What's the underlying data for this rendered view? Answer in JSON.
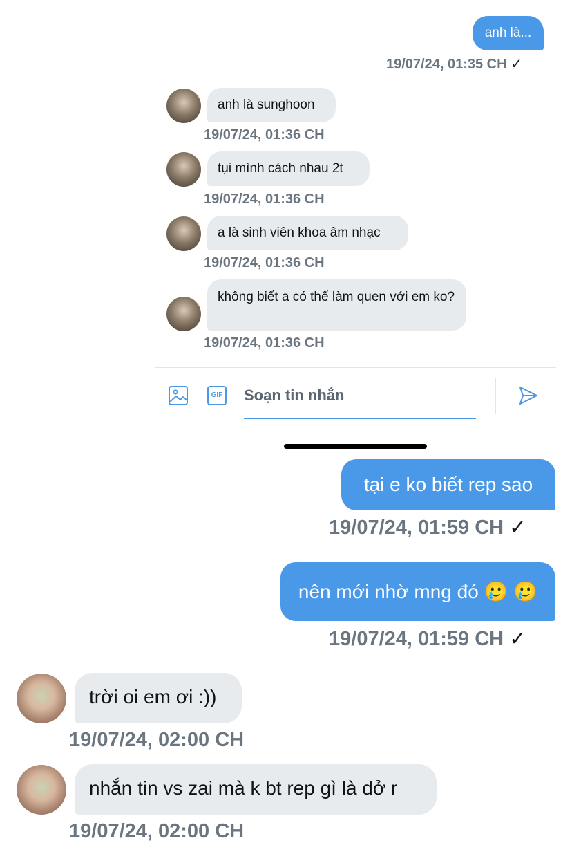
{
  "colors": {
    "accent": "#4a99e9",
    "incoming_bubble": "#e8ebee",
    "timestamp": "#6a7580"
  },
  "top_thread": {
    "outgoing": {
      "text": "anh là...",
      "time": "19/07/24, 01:35 CH",
      "check": "✓"
    },
    "incoming": [
      {
        "text": "anh là sunghoon",
        "time": "19/07/24, 01:36 CH"
      },
      {
        "text": "tụi mình cách nhau 2t",
        "time": "19/07/24, 01:36 CH"
      },
      {
        "text": "a là sinh viên khoa âm nhạc",
        "time": "19/07/24, 01:36 CH"
      },
      {
        "text": "không biết a có thể làm quen với em ko?",
        "time": "19/07/24, 01:36 CH"
      }
    ],
    "composer": {
      "placeholder": "Soạn tin nhắn",
      "image_icon": "image-icon",
      "gif_label": "GIF",
      "send_icon": "send-icon"
    }
  },
  "bottom_thread": {
    "outgoing": [
      {
        "text": "tại e ko biết rep sao",
        "time": "19/07/24, 01:59 CH",
        "check": "✓"
      },
      {
        "text": "nên mới nhờ mng đó 🥲 🥲",
        "time": "19/07/24, 01:59 CH",
        "check": "✓"
      }
    ],
    "incoming": [
      {
        "text": "trời oi em ơi :))",
        "time": "19/07/24, 02:00 CH"
      },
      {
        "text": "nhắn tin vs zai mà k bt rep gì là dở r",
        "time": "19/07/24, 02:00 CH"
      }
    ]
  }
}
